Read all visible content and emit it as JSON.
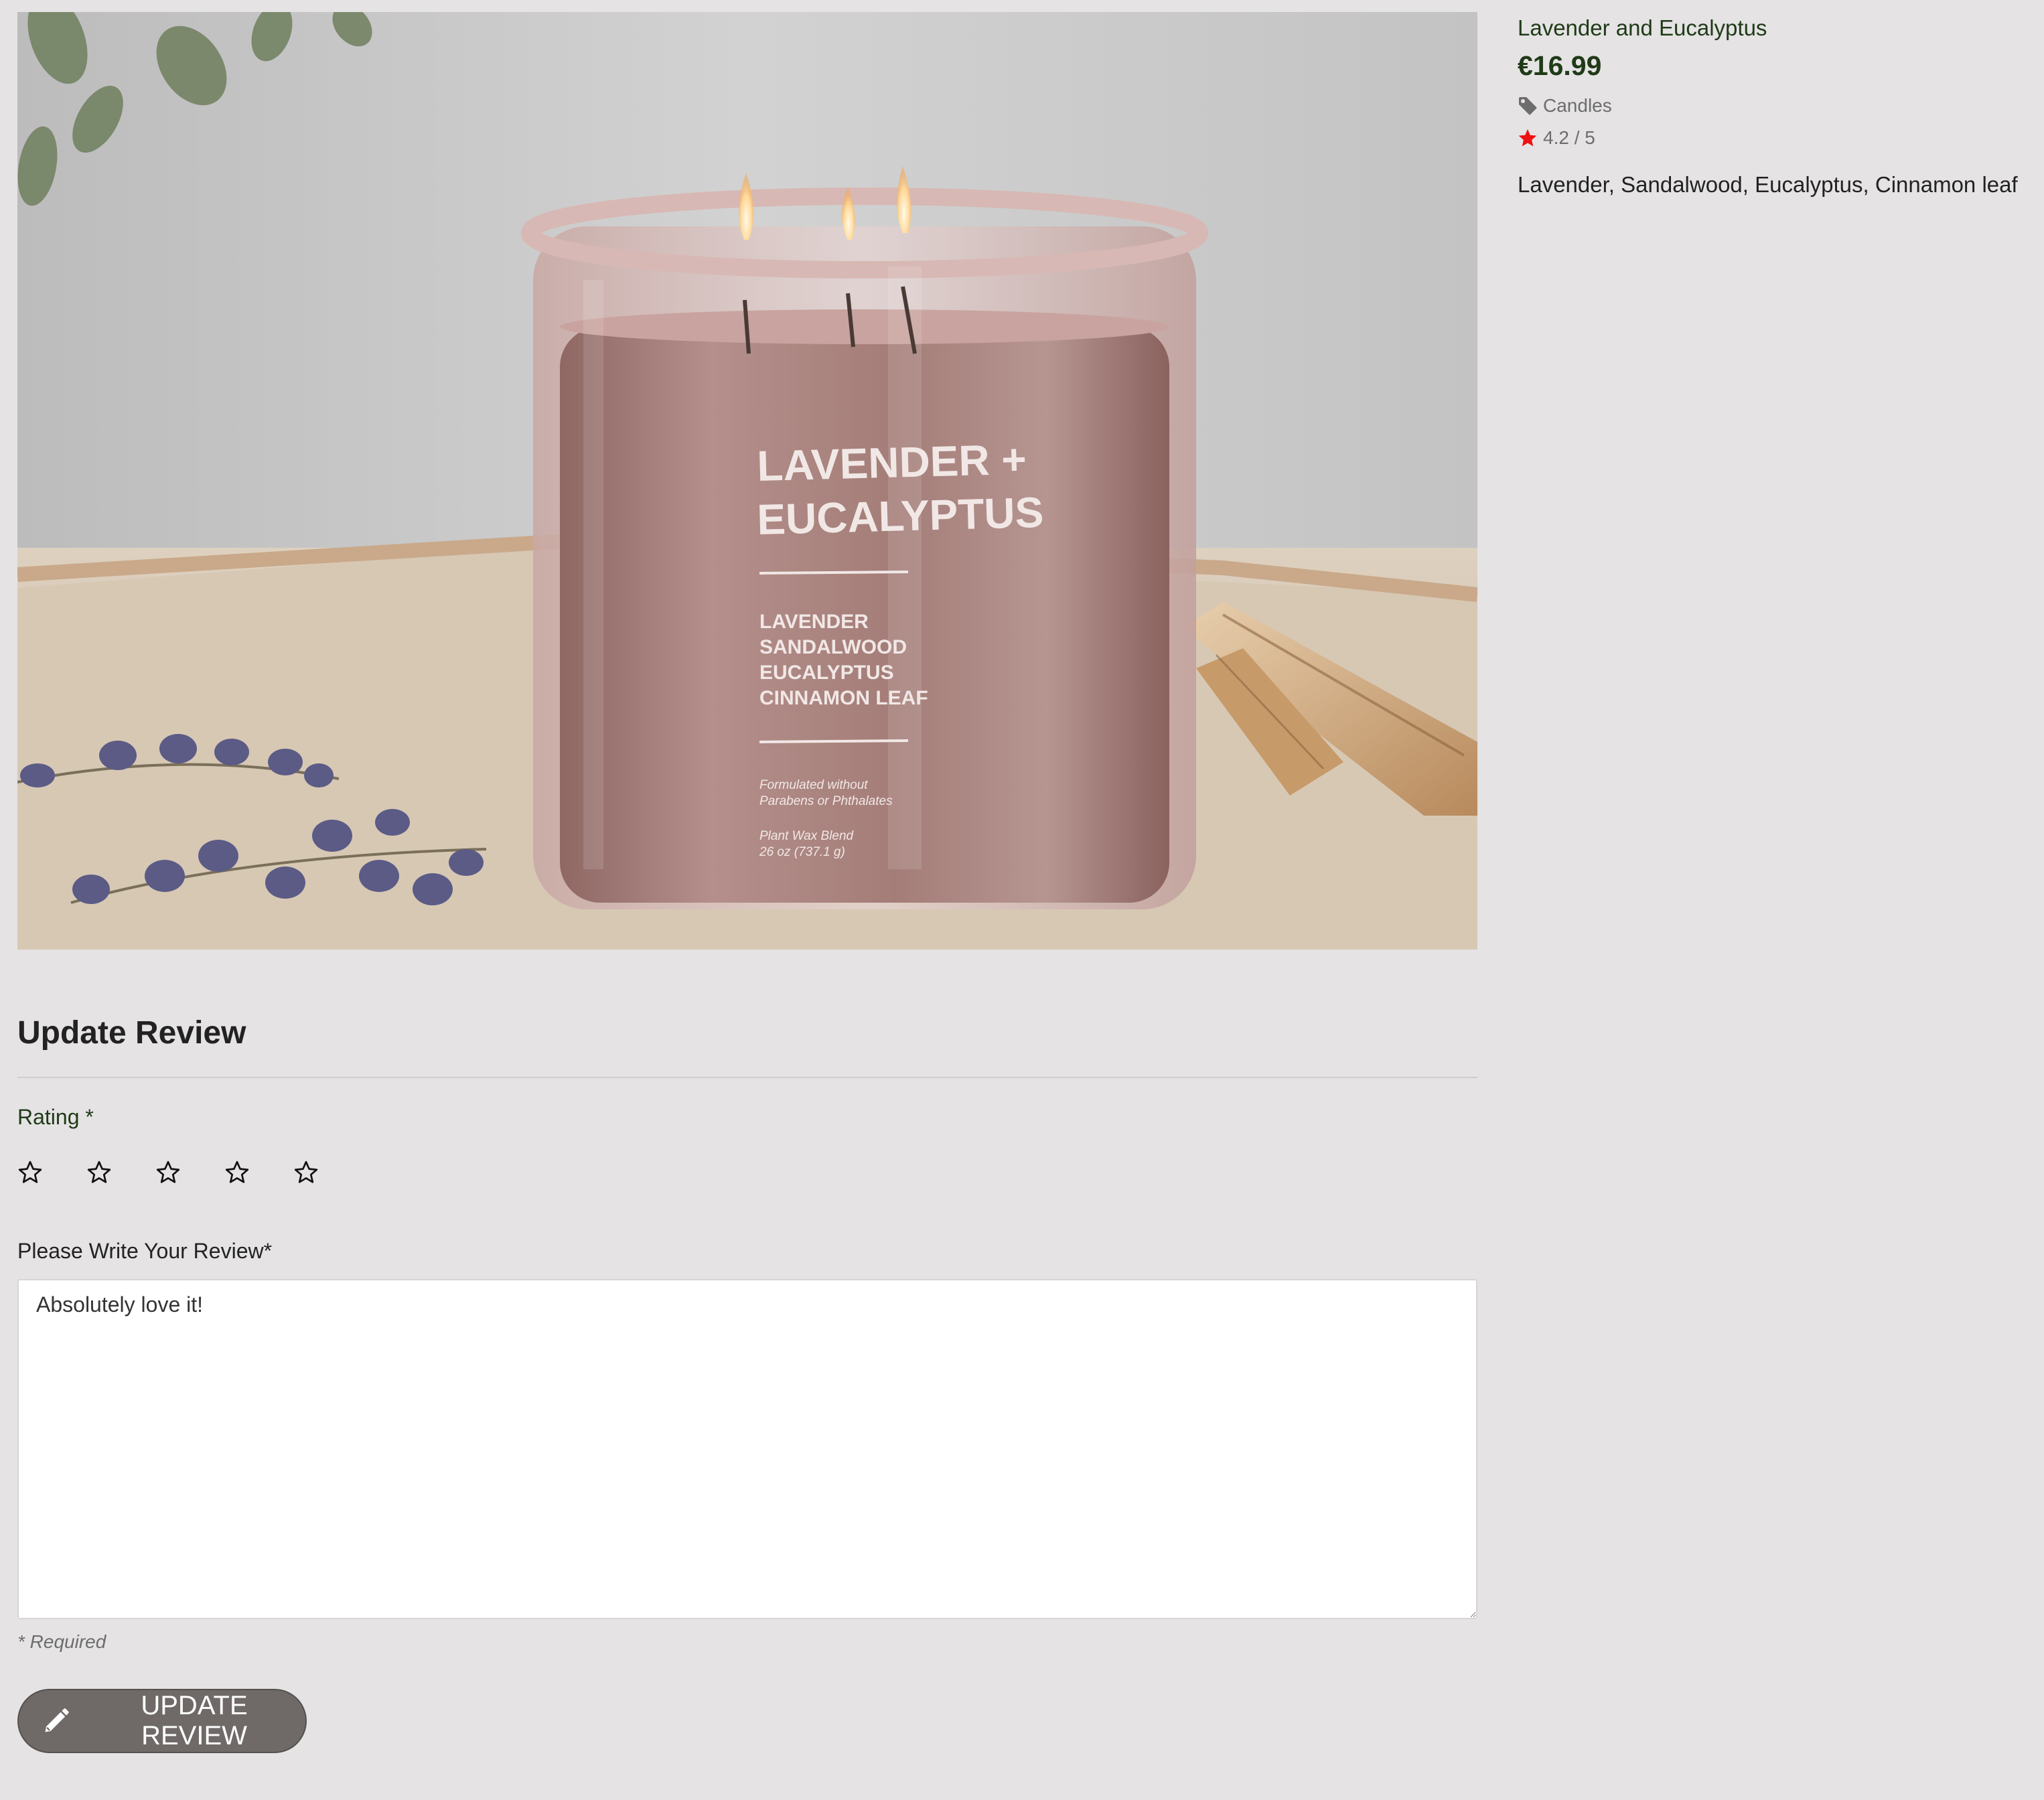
{
  "product": {
    "name": "Lavender and Eucalyptus",
    "price": "€16.99",
    "category": "Candles",
    "rating": "4.2 / 5",
    "notes": "Lavender, Sandalwood, Eucalyptus, Cinnamon leaf",
    "image": {
      "label_line1": "LAVENDER +",
      "label_line2": "EUCALYPTUS",
      "ingredient_1": "LAVENDER",
      "ingredient_2": "SANDALWOOD",
      "ingredient_3": "EUCALYPTUS",
      "ingredient_4": "CINNAMON LEAF",
      "fine_1": "Formulated without",
      "fine_2": "Parabens or Phthalates",
      "fine_3": "Plant Wax Blend",
      "fine_4": "26 oz (737.1 g)"
    }
  },
  "review": {
    "title": "Update Review",
    "rating_label": "Rating *",
    "review_label": "Please Write Your Review*",
    "review_text": "Absolutely love it!",
    "required_note": "* Required",
    "submit_label": "UPDATE REVIEW",
    "stars": [
      "1",
      "2",
      "3",
      "4",
      "5"
    ]
  },
  "icons": {
    "category": "tag-icon",
    "rating": "star-icon",
    "submit": "pencil-icon",
    "rating_input": "star-outline-icon"
  },
  "colors": {
    "background": "#e5e3e4",
    "accent_green": "#1f3a17",
    "rating_star": "#ee1111",
    "button": "#6f6a68"
  }
}
